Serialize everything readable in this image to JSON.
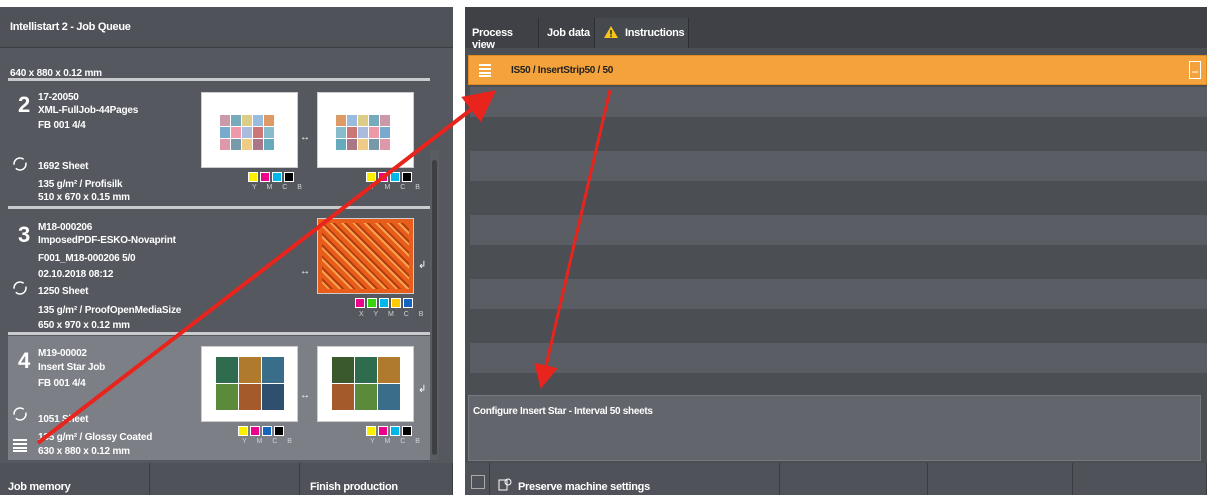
{
  "left_panel": {
    "title": "Intellistart 2 - Job Queue",
    "top_partial": "640 x 880 x 0.12 mm",
    "jobs": [
      {
        "number": "2",
        "id": "17-20050",
        "name": "XML-FullJob-44Pages",
        "fb": "FB 001  4/4",
        "date": "",
        "sheets": "1692 Sheet",
        "paper": "135 g/m²  /  Profisilk",
        "size": "510 x 670 x 0.15 mm",
        "swatch_labels": "Y M C B"
      },
      {
        "number": "3",
        "id": "M18-000206",
        "name": "ImposedPDF-ESKO-Novaprint",
        "fb": "F001_M18-000206  5/0",
        "date": "02.10.2018 08:12",
        "sheets": "1250 Sheet",
        "paper": "135 g/m²  /  ProofOpenMediaSize",
        "size": "650 x 970 x 0.12 mm",
        "swatch_labels": "X Y M C B"
      },
      {
        "number": "4",
        "id": "M19-00002",
        "name": "Insert Star Job",
        "fb": "FB 001  4/4",
        "date": "",
        "sheets": "1051 Sheet",
        "paper": "135 g/m²  /  Glossy Coated",
        "size": "630 x 880 x 0.12 mm",
        "swatch_labels": "Y M C B"
      }
    ],
    "footer": {
      "job_memory": "Job memory",
      "finish_production": "Finish production"
    }
  },
  "right_panel": {
    "tabs": [
      {
        "label": "Process view"
      },
      {
        "label": "Job data"
      },
      {
        "label": "Instructions"
      }
    ],
    "selected_row": "IS50 / InsertStrip50 / 50",
    "config_text": "Configure Insert Star - Interval 50 sheets",
    "footer": {
      "preserve": "Preserve machine settings"
    }
  },
  "colors": {
    "accent": "#f4a23c",
    "arrow": "#e8241c",
    "panel": "#55585e"
  }
}
